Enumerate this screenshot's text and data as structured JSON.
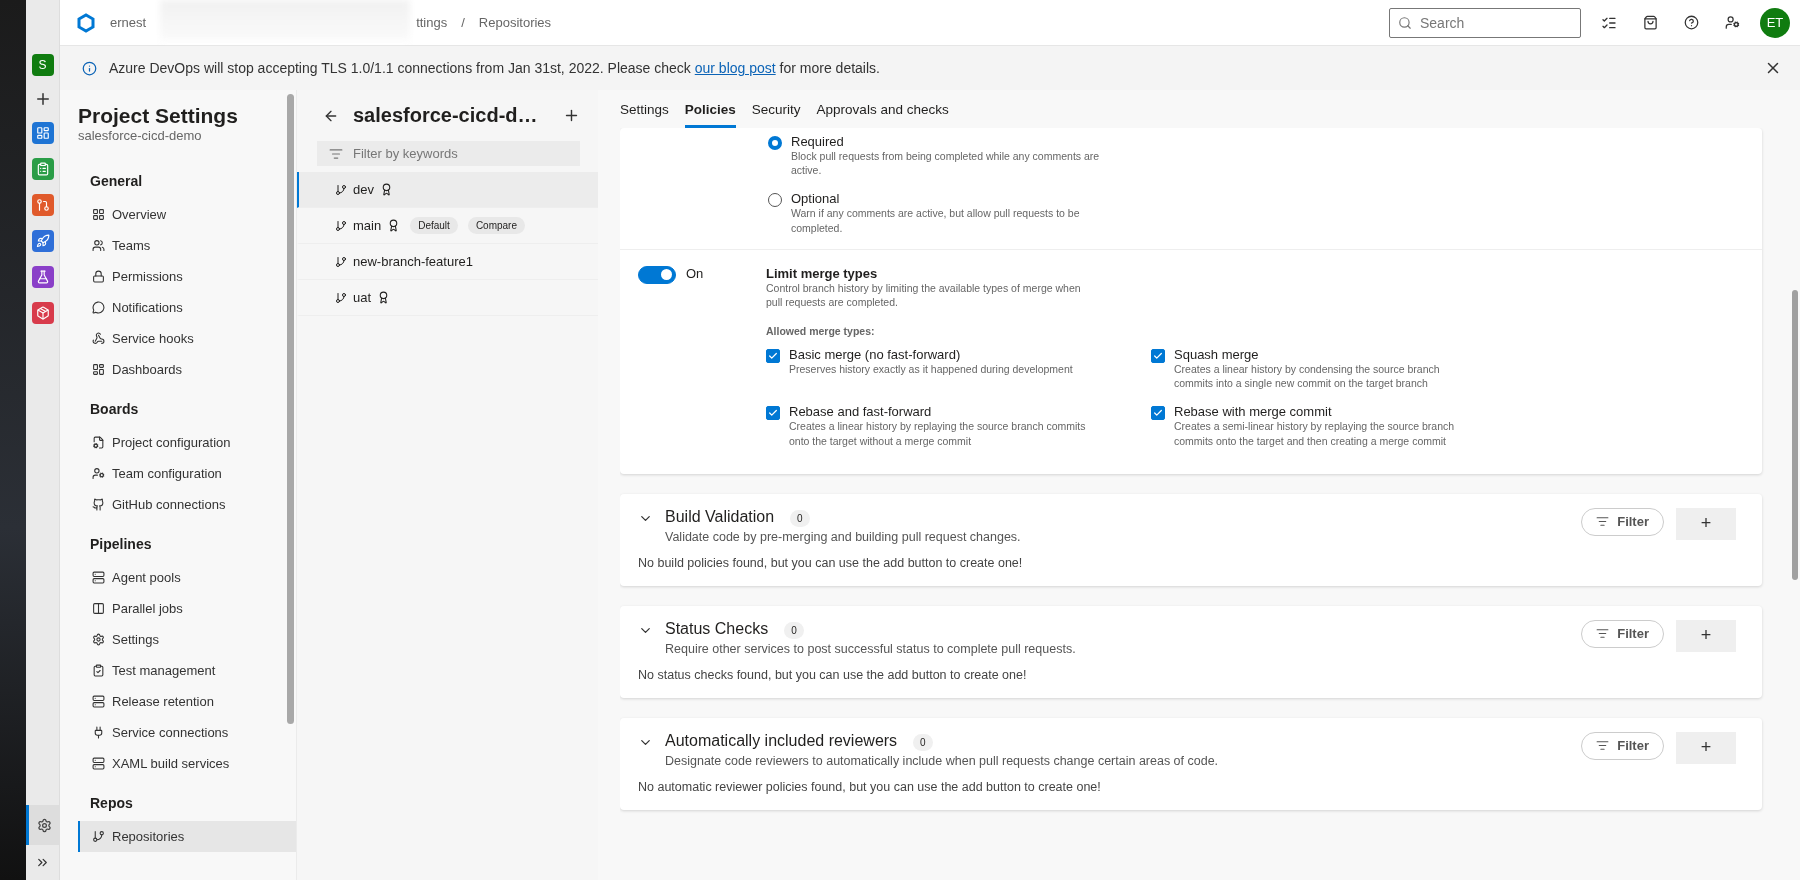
{
  "topbar": {
    "breadcrumb": [
      "ernest",
      "ttings",
      "Repositories"
    ],
    "breadcrumb_separator": "/",
    "search": {
      "placeholder": "Search"
    },
    "avatar": "ET"
  },
  "banner": {
    "text": "Azure DevOps will stop accepting TLS 1.0/1.1 connections from Jan 31st, 2022. Please check",
    "link": "our blog post",
    "after": "for more details."
  },
  "rail": {
    "org_initial": "S"
  },
  "settings_nav": {
    "title": "Project Settings",
    "subtitle": "salesforce-cicd-demo",
    "sections": [
      {
        "heading": "General",
        "items": [
          {
            "label": "Overview",
            "selected": false
          },
          {
            "label": "Teams",
            "selected": false
          },
          {
            "label": "Permissions",
            "selected": false
          },
          {
            "label": "Notifications",
            "selected": false
          },
          {
            "label": "Service hooks",
            "selected": false
          },
          {
            "label": "Dashboards",
            "selected": false
          }
        ]
      },
      {
        "heading": "Boards",
        "items": [
          {
            "label": "Project configuration",
            "selected": false
          },
          {
            "label": "Team configuration",
            "selected": false
          },
          {
            "label": "GitHub connections",
            "selected": false
          }
        ]
      },
      {
        "heading": "Pipelines",
        "items": [
          {
            "label": "Agent pools",
            "selected": false
          },
          {
            "label": "Parallel jobs",
            "selected": false
          },
          {
            "label": "Settings",
            "selected": false
          },
          {
            "label": "Test management",
            "selected": false
          },
          {
            "label": "Release retention",
            "selected": false
          },
          {
            "label": "Service connections",
            "selected": false
          },
          {
            "label": "XAML build services",
            "selected": false
          }
        ]
      },
      {
        "heading": "Repos",
        "items": [
          {
            "label": "Repositories",
            "selected": true
          }
        ]
      }
    ]
  },
  "branches": {
    "title": "salesforce-cicd-d…",
    "filter": {
      "placeholder": "Filter by keywords"
    },
    "items": [
      {
        "name": "dev",
        "selected": true,
        "has_policy": true
      },
      {
        "name": "main",
        "selected": false,
        "has_policy": true,
        "tags": [
          "Default",
          "Compare"
        ]
      },
      {
        "name": "new-branch-feature1",
        "selected": false,
        "has_policy": false
      },
      {
        "name": "uat",
        "selected": false,
        "has_policy": true
      }
    ]
  },
  "tabs": [
    {
      "label": "Settings",
      "selected": false
    },
    {
      "label": "Policies",
      "selected": true
    },
    {
      "label": "Security",
      "selected": false
    },
    {
      "label": "Approvals and checks",
      "selected": false
    }
  ],
  "comment_resolution": {
    "options": [
      {
        "label": "Required",
        "description": "Block pull requests from being completed while any comments are active.",
        "selected": true
      },
      {
        "label": "Optional",
        "description": "Warn if any comments are active, but allow pull requests to be completed.",
        "selected": false
      }
    ]
  },
  "merge_types": {
    "on": true,
    "state_label": "On",
    "title": "Limit merge types",
    "description": "Control branch history by limiting the available types of merge when pull requests are completed.",
    "allowed_label": "Allowed merge types:",
    "options": [
      {
        "label": "Basic merge (no fast-forward)",
        "description": "Preserves history exactly as it happened during development",
        "checked": true
      },
      {
        "label": "Squash merge",
        "description": "Creates a linear history by condensing the source branch commits into a single new commit on the target branch",
        "checked": true
      },
      {
        "label": "Rebase and fast-forward",
        "description": "Creates a linear history by replaying the source branch commits onto the target without a merge commit",
        "checked": true
      },
      {
        "label": "Rebase with merge commit",
        "description": "Creates a semi-linear history by replaying the source branch commits onto the target and then creating a merge commit",
        "checked": true
      }
    ]
  },
  "policy_sections": [
    {
      "title": "Build Validation",
      "count": "0",
      "description": "Validate code by pre-merging and building pull request changes.",
      "empty": "No build policies found, but you can use the add button to create one!",
      "filter": "Filter",
      "add": "+"
    },
    {
      "title": "Status Checks",
      "count": "0",
      "description": "Require other services to post successful status to complete pull requests.",
      "empty": "No status checks found, but you can use the add button to create one!",
      "filter": "Filter",
      "add": "+"
    },
    {
      "title": "Automatically included reviewers",
      "count": "0",
      "description": "Designate code reviewers to automatically include when pull requests change certain areas of code.",
      "empty": "No automatic reviewer policies found, but you can use the add button to create one!",
      "filter": "Filter",
      "add": "+"
    }
  ]
}
